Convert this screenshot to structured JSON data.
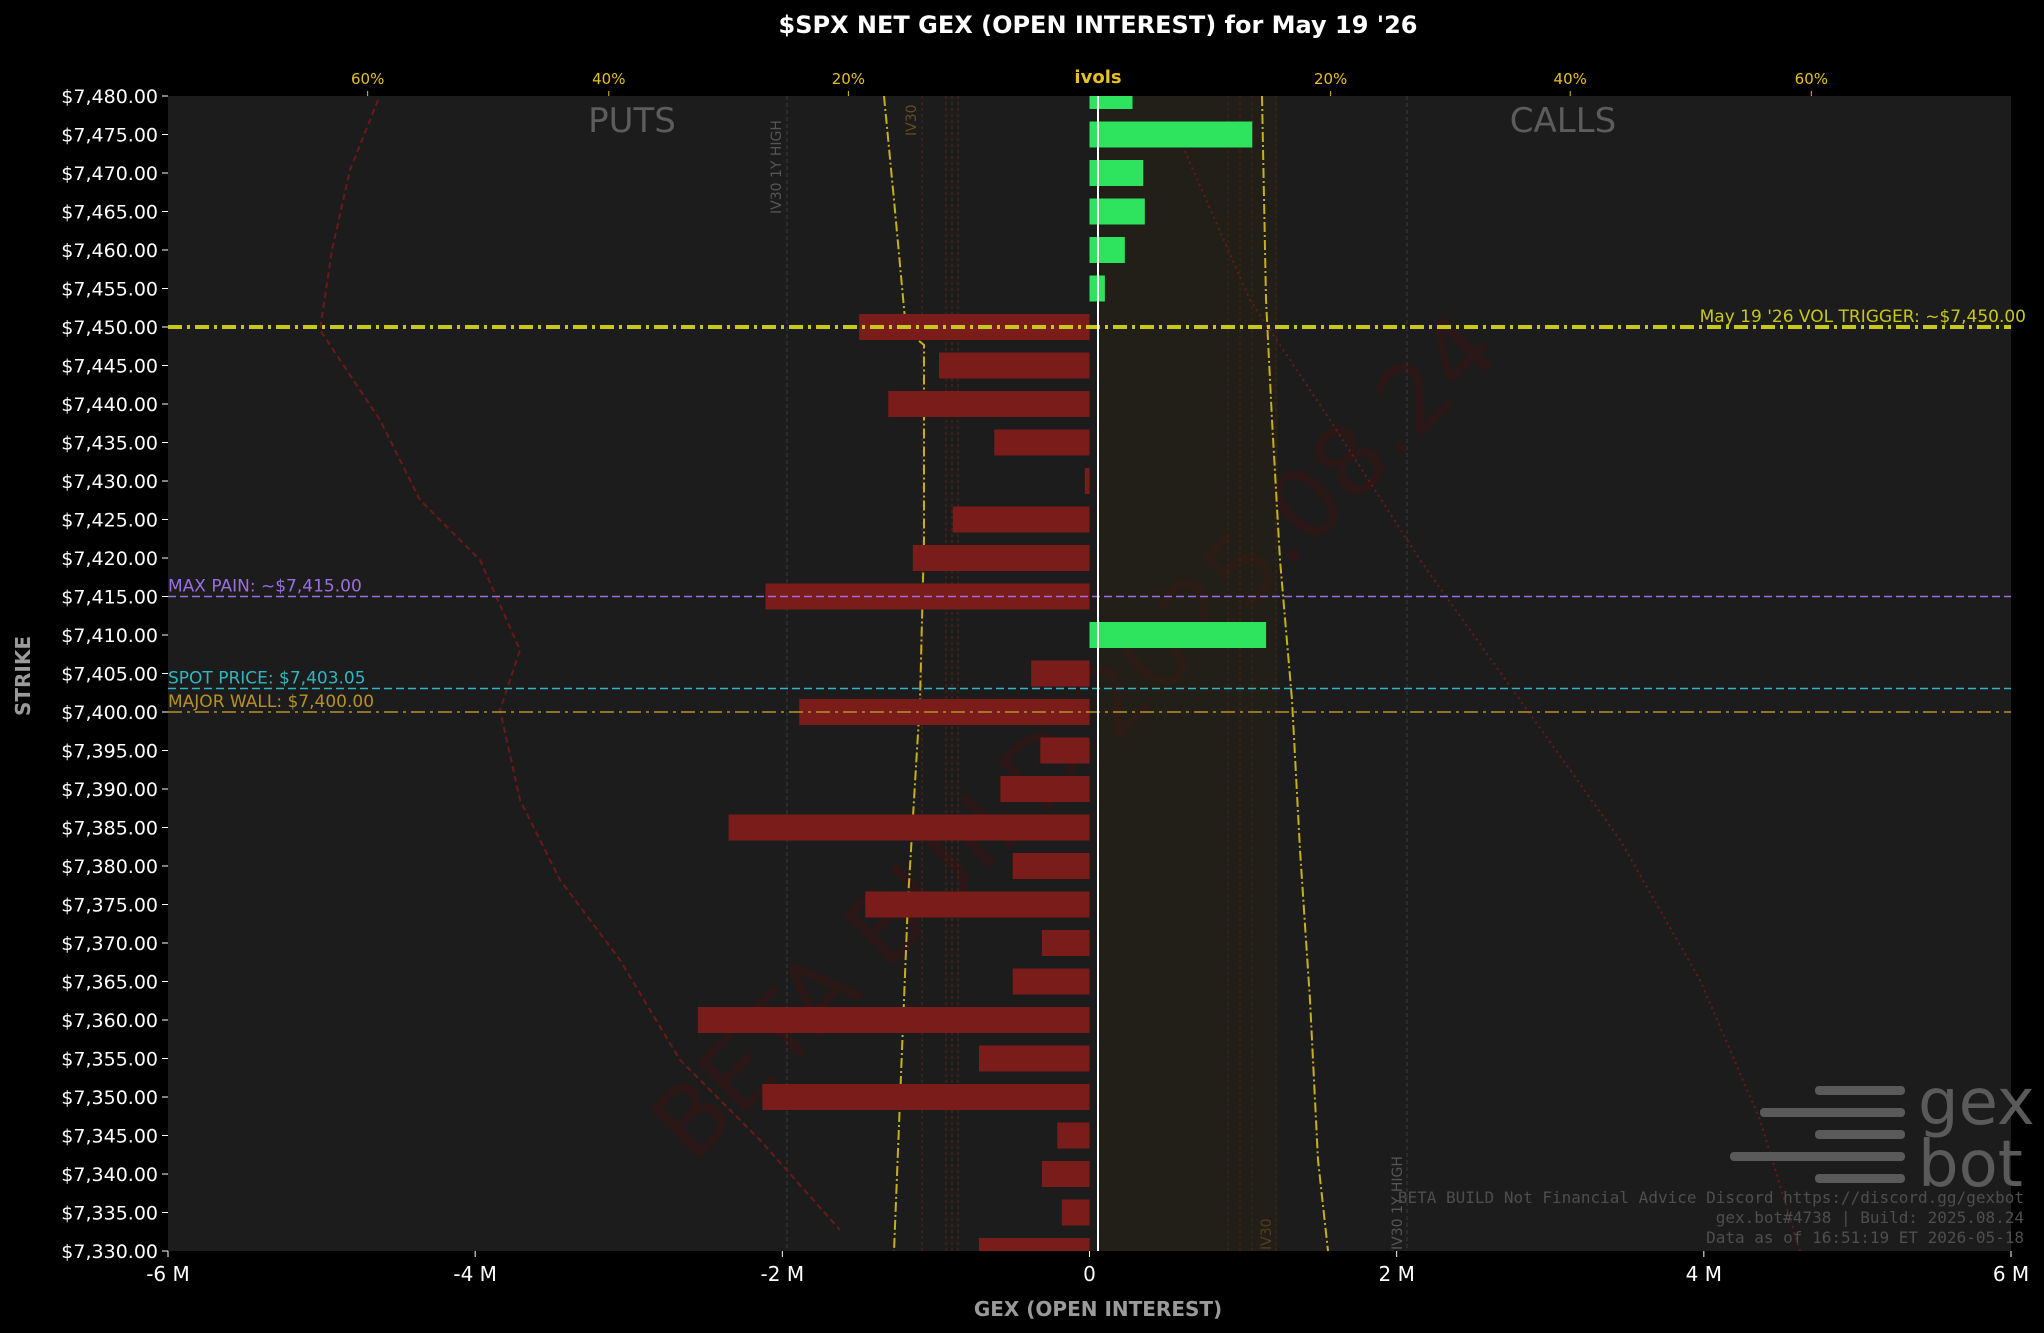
{
  "chart_data": {
    "type": "bar",
    "orientation": "horizontal",
    "title": "$SPX NET GEX (OPEN INTEREST) for May 19 '26",
    "xlabel": "GEX (OPEN INTEREST)",
    "ylabel": "STRIKE",
    "top_axis_label": "ivols",
    "xlim": [
      -6000000,
      6000000
    ],
    "ylim": [
      7330,
      7480
    ],
    "x_ticks": [
      {
        "value": -6000000,
        "label": "-6 M"
      },
      {
        "value": -4000000,
        "label": "-4 M"
      },
      {
        "value": -2000000,
        "label": "-2 M"
      },
      {
        "value": 0,
        "label": "0"
      },
      {
        "value": 2000000,
        "label": "2 M"
      },
      {
        "value": 4000000,
        "label": "4 M"
      },
      {
        "value": 6000000,
        "label": "6 M"
      }
    ],
    "top_ticks": [
      {
        "value": -4700000,
        "label": "60%"
      },
      {
        "value": -3130000,
        "label": "40%"
      },
      {
        "value": -1570000,
        "label": "20%"
      },
      {
        "value": 1570000,
        "label": "20%"
      },
      {
        "value": 3130000,
        "label": "40%"
      },
      {
        "value": 4700000,
        "label": "60%"
      }
    ],
    "y_ticks": [
      {
        "value": 7480,
        "label": "$7,480.00"
      },
      {
        "value": 7475,
        "label": "$7,475.00"
      },
      {
        "value": 7470,
        "label": "$7,470.00"
      },
      {
        "value": 7465,
        "label": "$7,465.00"
      },
      {
        "value": 7460,
        "label": "$7,460.00"
      },
      {
        "value": 7455,
        "label": "$7,455.00"
      },
      {
        "value": 7450,
        "label": "$7,450.00"
      },
      {
        "value": 7445,
        "label": "$7,445.00"
      },
      {
        "value": 7440,
        "label": "$7,440.00"
      },
      {
        "value": 7435,
        "label": "$7,435.00"
      },
      {
        "value": 7430,
        "label": "$7,430.00"
      },
      {
        "value": 7425,
        "label": "$7,425.00"
      },
      {
        "value": 7420,
        "label": "$7,420.00"
      },
      {
        "value": 7415,
        "label": "$7,415.00"
      },
      {
        "value": 7410,
        "label": "$7,410.00"
      },
      {
        "value": 7405,
        "label": "$7,405.00"
      },
      {
        "value": 7400,
        "label": "$7,400.00"
      },
      {
        "value": 7395,
        "label": "$7,395.00"
      },
      {
        "value": 7390,
        "label": "$7,390.00"
      },
      {
        "value": 7385,
        "label": "$7,385.00"
      },
      {
        "value": 7380,
        "label": "$7,380.00"
      },
      {
        "value": 7375,
        "label": "$7,375.00"
      },
      {
        "value": 7370,
        "label": "$7,370.00"
      },
      {
        "value": 7365,
        "label": "$7,365.00"
      },
      {
        "value": 7360,
        "label": "$7,360.00"
      },
      {
        "value": 7355,
        "label": "$7,355.00"
      },
      {
        "value": 7350,
        "label": "$7,350.00"
      },
      {
        "value": 7345,
        "label": "$7,345.00"
      },
      {
        "value": 7340,
        "label": "$7,340.00"
      },
      {
        "value": 7335,
        "label": "$7,335.00"
      },
      {
        "value": 7330,
        "label": "$7,330.00"
      }
    ],
    "bars": [
      {
        "strike": 7480,
        "value": 280000
      },
      {
        "strike": 7475,
        "value": 1060000
      },
      {
        "strike": 7470,
        "value": 350000
      },
      {
        "strike": 7465,
        "value": 360000
      },
      {
        "strike": 7460,
        "value": 230000
      },
      {
        "strike": 7455,
        "value": 100000
      },
      {
        "strike": 7450,
        "value": -1500000
      },
      {
        "strike": 7445,
        "value": -980000
      },
      {
        "strike": 7440,
        "value": -1310000
      },
      {
        "strike": 7435,
        "value": -620000
      },
      {
        "strike": 7430,
        "value": -30000
      },
      {
        "strike": 7425,
        "value": -890000
      },
      {
        "strike": 7420,
        "value": -1150000
      },
      {
        "strike": 7415,
        "value": -2110000
      },
      {
        "strike": 7410,
        "value": 1150000
      },
      {
        "strike": 7405,
        "value": -380000
      },
      {
        "strike": 7400,
        "value": -1890000
      },
      {
        "strike": 7395,
        "value": -320000
      },
      {
        "strike": 7390,
        "value": -580000
      },
      {
        "strike": 7385,
        "value": -2350000
      },
      {
        "strike": 7380,
        "value": -500000
      },
      {
        "strike": 7375,
        "value": -1460000
      },
      {
        "strike": 7370,
        "value": -310000
      },
      {
        "strike": 7365,
        "value": -500000
      },
      {
        "strike": 7360,
        "value": -2550000
      },
      {
        "strike": 7355,
        "value": -720000
      },
      {
        "strike": 7350,
        "value": -2130000
      },
      {
        "strike": 7345,
        "value": -210000
      },
      {
        "strike": 7340,
        "value": -310000
      },
      {
        "strike": 7335,
        "value": -180000
      },
      {
        "strike": 7330,
        "value": -720000
      }
    ],
    "side_labels": {
      "left": "PUTS",
      "right": "CALLS"
    },
    "reference_lines": [
      {
        "strike": 7450,
        "label": "May 19 '26 VOL TRIGGER: ~$7,450.00",
        "color": "#c8c81a",
        "style": "dashdot",
        "label_side": "right"
      },
      {
        "strike": 7415,
        "label": "MAX PAIN: ~$7,415.00",
        "color": "#9b6fe0",
        "style": "dashed",
        "label_side": "left"
      },
      {
        "strike": 7403.05,
        "label": "SPOT PRICE: $7,403.05",
        "color": "#2fb6c2",
        "style": "dashed",
        "label_side": "left"
      },
      {
        "strike": 7400,
        "label": "MAJOR WALL: $7,400.00",
        "color": "#b8902a",
        "style": "dashdot",
        "label_side": "left"
      }
    ],
    "ivol_vertical_labels": {
      "put_iv30_1y_high": "IV30 1Y HIGH",
      "call_iv30_1y_high": "IV30 1Y HIGH",
      "iv30": "IV30"
    },
    "colors": {
      "background": "#000000",
      "plot_bg": "#1c1c1c",
      "positive": "#2ee35e",
      "negative": "#7a1d1a",
      "ivol_line": "#c8b01a",
      "axis_text": "#ffffff",
      "top_tick_text": "#e6c21a",
      "axis_label": "#9a9a9a"
    },
    "grid": false,
    "legend": "none"
  },
  "brand": {
    "logo_line1": "gex",
    "logo_line2": "bot",
    "footer_line1": "BETA BUILD Not Financial Advice Discord https://discord.gg/gexbot",
    "footer_line2": "gex.bot#4738 | Build: 2025.08.24",
    "footer_line3": "Data as of 16:51:19 ET 2026-05-18",
    "watermark": "BETA BUILD 2025.08.24"
  }
}
